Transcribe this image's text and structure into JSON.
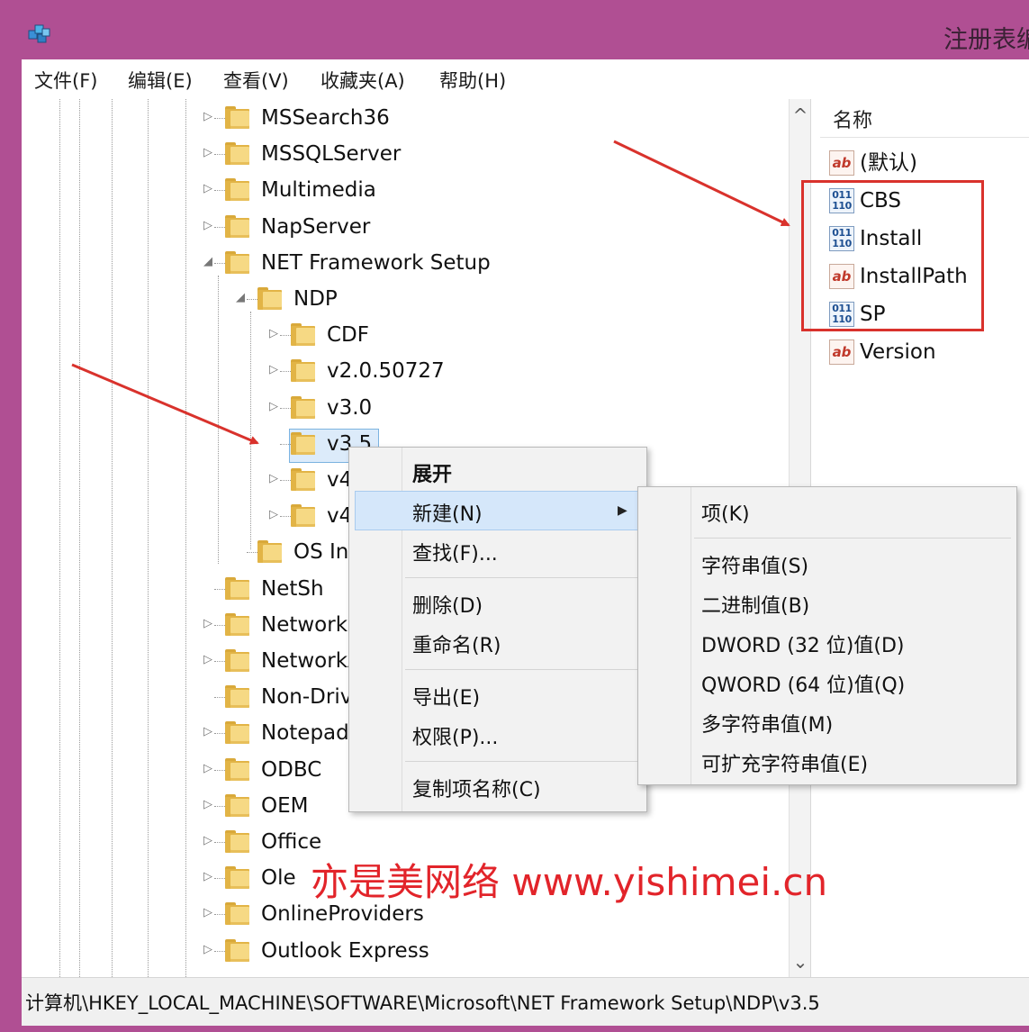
{
  "window": {
    "title": "注册表编"
  },
  "menubar": [
    "文件(F)",
    "编辑(E)",
    "查看(V)",
    "收藏夹(A)",
    "帮助(H)"
  ],
  "tree": {
    "nodes": [
      {
        "label": "MSSearch36",
        "expander": "▷"
      },
      {
        "label": "MSSQLServer",
        "expander": "▷"
      },
      {
        "label": "Multimedia",
        "expander": "▷"
      },
      {
        "label": "NapServer",
        "expander": "▷"
      },
      {
        "label": "NET Framework Setup",
        "expander": "◢"
      },
      {
        "label": "NDP",
        "expander": "◢"
      },
      {
        "label": "CDF",
        "expander": "▷"
      },
      {
        "label": "v2.0.50727",
        "expander": "▷"
      },
      {
        "label": "v3.0",
        "expander": "▷"
      },
      {
        "label": "v3.5",
        "expander": ""
      },
      {
        "label": "v4",
        "expander": "▷"
      },
      {
        "label": "v4.0",
        "expander": "▷"
      },
      {
        "label": "OS Inte",
        "expander": ""
      },
      {
        "label": "NetSh",
        "expander": ""
      },
      {
        "label": "Network",
        "expander": "▷"
      },
      {
        "label": "NetworkAc",
        "expander": "▷"
      },
      {
        "label": "Non-Drive",
        "expander": ""
      },
      {
        "label": "Notepad",
        "expander": "▷"
      },
      {
        "label": "ODBC",
        "expander": "▷"
      },
      {
        "label": "OEM",
        "expander": "▷"
      },
      {
        "label": "Office",
        "expander": "▷"
      },
      {
        "label": "Ole",
        "expander": "▷"
      },
      {
        "label": "OnlineProviders",
        "expander": "▷"
      },
      {
        "label": "Outlook Express",
        "expander": "▷"
      }
    ],
    "scroll_up": "^",
    "scroll_down": "⌄"
  },
  "values": {
    "column_header": "名称",
    "items": [
      {
        "name": "(默认)",
        "type": "sz",
        "icon_text": "ab"
      },
      {
        "name": "CBS",
        "type": "bin",
        "icon_text": "011 110"
      },
      {
        "name": "Install",
        "type": "bin",
        "icon_text": "011 110"
      },
      {
        "name": "InstallPath",
        "type": "sz",
        "icon_text": "ab"
      },
      {
        "name": "SP",
        "type": "bin",
        "icon_text": "011 110"
      },
      {
        "name": "Version",
        "type": "sz",
        "icon_text": "ab"
      }
    ]
  },
  "context_menu": {
    "items": [
      "展开",
      "新建(N)",
      "查找(F)...",
      "删除(D)",
      "重命名(R)",
      "导出(E)",
      "权限(P)...",
      "复制项名称(C)"
    ],
    "submenu_arrow": "▶"
  },
  "submenu": {
    "items": [
      "项(K)",
      "字符串值(S)",
      "二进制值(B)",
      "DWORD (32 位)值(D)",
      "QWORD (64 位)值(Q)",
      "多字符串值(M)",
      "可扩充字符串值(E)"
    ]
  },
  "statusbar": {
    "path": "计算机\\HKEY_LOCAL_MACHINE\\SOFTWARE\\Microsoft\\NET Framework Setup\\NDP\\v3.5"
  },
  "watermark": {
    "text": "亦是美网络 www.yishimei.cn"
  },
  "colors": {
    "title_bar": "#b04f93",
    "highlight": "#d9322c",
    "selection": "#dcebfa"
  }
}
